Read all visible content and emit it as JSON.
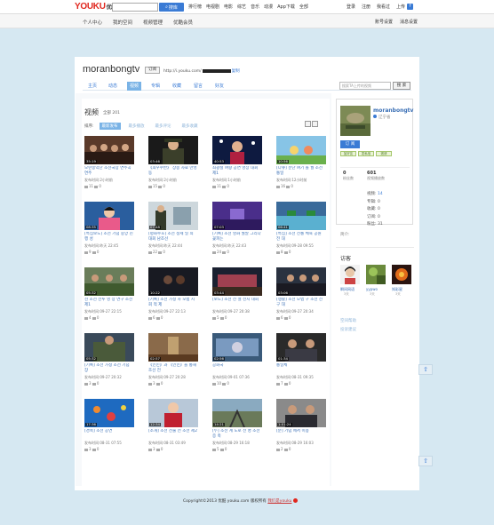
{
  "topbar": {
    "logo": "YOUKU",
    "logo_sub": "优酷",
    "search_btn": "搜库",
    "nav": [
      "排行榜",
      "电视剧",
      "电影",
      "综艺",
      "音乐",
      "动漫",
      "App下载",
      "全部"
    ],
    "right": [
      "登录",
      "注册",
      "我看过"
    ],
    "upload": "上传"
  },
  "subbar": {
    "nav": [
      "个人中心",
      "我的空间",
      "视频管理",
      "优酷会员"
    ],
    "right": [
      "账号设置",
      "消息设置"
    ]
  },
  "channel": {
    "name": "moranbongtv",
    "subscribe_btn": "订阅",
    "url_prefix": "http://i.youku.com/",
    "copy": "复制"
  },
  "tabs": [
    "主页",
    "动态",
    "视频",
    "专辑",
    "收藏",
    "留言",
    "好友"
  ],
  "active_tab": "视频",
  "site_search": {
    "placeholder": "搜索TA上传的视频",
    "button": "搜 索"
  },
  "videos_section": {
    "title": "视频",
    "count": "全部 201",
    "sort_label": "排序:",
    "sort_options": [
      "最新发布",
      "最多播放",
      "最多评论",
      "最多收藏"
    ]
  },
  "videos": [
    {
      "dur": "35:19",
      "title": "모란봉악단 조선국장 연주곡 연주",
      "date": "发布时间:2小时前",
      "views": "11",
      "comments": "0",
      "thumb": "crowd"
    },
    {
      "dur": "03:46",
      "title": "《최우수반》 상봉 자료 만영 동",
      "date": "发布时间:2小时前",
      "views": "15",
      "comments": "0",
      "thumb": "officer"
    },
    {
      "dur": "40:53",
      "title": "최광철 여왕 공연 영상 대회 제1",
      "date": "发布时间:1小时前",
      "views": "11",
      "comments": "0",
      "thumb": "singer"
    },
    {
      "dur": "10:56",
      "title": "[다큐] 분단 여기 돌 월 조선 통일",
      "date": "发布时间:12小时前",
      "views": "16",
      "comments": "0",
      "thumb": "cartoon"
    },
    {
      "dur": "08:35",
      "title": "[특집보도] 조선 기념 중앙 진행 성",
      "date": "发布时间:昨天 22:45",
      "views": "9",
      "comments": "0",
      "thumb": "anchor"
    },
    {
      "dur": "07:48",
      "title": "[평화수호] 조선 정세 일 의 대회 남조선",
      "date": "发布时间:昨天 22:44",
      "views": "22",
      "comments": "0",
      "thumb": "officer2"
    },
    {
      "dur": "07:03",
      "title": "[기록] 조선 영화 월말 그리다 꽃피는",
      "date": "发布时间:昨天 22:43",
      "views": "24",
      "comments": "0",
      "thumb": "purple"
    },
    {
      "dur": "06:41",
      "title": "[특집] 조선 전통 체육 공원 전 대",
      "date": "发布时间:09-28 09:55",
      "views": "8",
      "comments": "0",
      "thumb": "lake"
    },
    {
      "dur": "05:32",
      "title": "선 조선 전투 영 상 연구 조선 제1",
      "date": "发布时间:09-27 22:15",
      "views": "4",
      "comments": "0",
      "thumb": "soldiers"
    },
    {
      "dur": "10:22",
      "title": "[기록] 조선 가정 사 모범 지회 적 제",
      "date": "发布时间:09-27 22:13",
      "views": "6",
      "comments": "0",
      "thumb": "dark"
    },
    {
      "dur": "03:44",
      "title": "[보도] 조선 전 설 전시 대회",
      "date": "发布时间:09-27 20:38",
      "views": "5",
      "comments": "0",
      "thumb": "stage"
    },
    {
      "dur": "03:06",
      "title": "[생활] 조선 모범 구 조선 전 구 대",
      "date": "发布时间:09-27 20:34",
      "views": "6",
      "comments": "0",
      "thumb": "seated"
    },
    {
      "dur": "05:32",
      "title": "[기록] 조선 가정 조선 기념 장",
      "date": "发布时间:09-27 20:32",
      "views": "3",
      "comments": "0",
      "thumb": "soldiers2"
    },
    {
      "dur": "02:57",
      "title": "《인민》과 《인민》을 통해 조선 전",
      "date": "发布时间:09-27 20:28",
      "views": "3",
      "comments": "0",
      "thumb": "monument"
    },
    {
      "dur": "02:56",
      "title": "공화국",
      "date": "发布时间:09-01 07:36",
      "views": "10",
      "comments": "0",
      "thumb": "mural"
    },
    {
      "dur": "01:34",
      "title": "통일체",
      "date": "发布时间:08-31 09:35",
      "views": "7",
      "comments": "0",
      "thumb": "men"
    },
    {
      "dur": "17:36",
      "title": "[경축] 조선 공연",
      "date": "发布时间:08-31 07:55",
      "views": "3",
      "comments": "0",
      "thumb": "fish"
    },
    {
      "dur": "12:34",
      "title": "[소개] 조선 선물 전 조선 제2",
      "date": "发布时间:08-31 03:49",
      "views": "3",
      "comments": "0",
      "thumb": "presenter"
    },
    {
      "dur": "14:21",
      "title": "[두] 조선 계 도로 전 명 조선 증 축",
      "date": "发布时间:08-29 16:18",
      "views": "5",
      "comments": "0",
      "thumb": "rail"
    },
    {
      "dur": "1:01:24",
      "title": "[분] 기념 에서 이용",
      "date": "发布时间:08-29 16:03",
      "views": "2",
      "comments": "0",
      "thumb": "men2"
    }
  ],
  "profile": {
    "name": "moranbongtv",
    "location": "辽宁省",
    "subscribe": "订 阅",
    "actions": [
      "加好友",
      "发私信",
      "邀请"
    ],
    "stats": [
      {
        "n": "0",
        "l": "粉丝数"
      },
      {
        "n": "601",
        "l": "视频播放数"
      }
    ],
    "list": [
      {
        "k": "视频:",
        "v": "14"
      },
      {
        "k": "专辑:",
        "v": "0"
      },
      {
        "k": "收藏:",
        "v": "0"
      },
      {
        "k": "订阅:",
        "v": "0"
      },
      {
        "k": "粉丝:",
        "v": "31"
      }
    ],
    "bio": "简介:"
  },
  "visitors": {
    "title": "访客",
    "items": [
      {
        "name": "瞬间网语",
        "time": "3天"
      },
      {
        "name": "yypwo",
        "time": "3天"
      },
      {
        "name": "知彩星",
        "time": "3天"
      }
    ]
  },
  "links": [
    "空间帮助",
    "投诉建议"
  ],
  "footer": {
    "text": "Copyright©2013 优酷 youku.com 版权所有",
    "link": "我们是youku"
  },
  "colors": {
    "accent": "#3a7bd5",
    "brand": "#e0261d",
    "page_bg": "#d6e8f2"
  }
}
